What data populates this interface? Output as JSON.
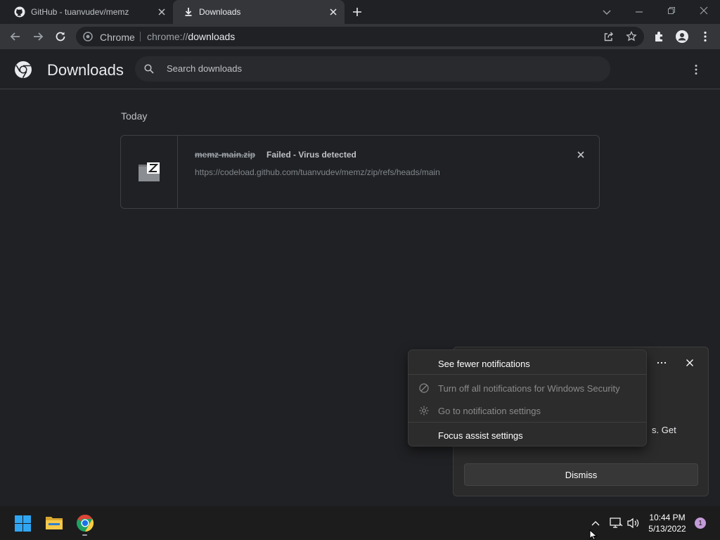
{
  "browser": {
    "tabs": [
      {
        "label": "GitHub - tuanvudev/memz",
        "icon": "github-icon",
        "active": false
      },
      {
        "label": "Downloads",
        "icon": "download-icon",
        "active": true
      }
    ],
    "omnibox": {
      "chip": "Chrome",
      "url_prefix": "chrome://",
      "url_path": "downloads"
    }
  },
  "downloads_page": {
    "title": "Downloads",
    "search_placeholder": "Search downloads",
    "sections": [
      {
        "heading": "Today",
        "items": [
          {
            "filename": "memz-main.zip",
            "status": "Failed - Virus detected",
            "url": "https://codeload.github.com/tuanvudev/memz/zip/refs/heads/main"
          }
        ]
      }
    ]
  },
  "notification": {
    "text_fragment": "s. Get",
    "dismiss_label": "Dismiss",
    "menu": [
      {
        "label": "See fewer notifications",
        "enabled": true,
        "icon": null
      },
      {
        "label": "Turn off all notifications for Windows Security",
        "enabled": false,
        "icon": "block-icon"
      },
      {
        "label": "Go to notification settings",
        "enabled": false,
        "icon": "gear-icon"
      },
      {
        "label": "Focus assist settings",
        "enabled": true,
        "icon": null
      }
    ]
  },
  "taskbar": {
    "time": "10:44 PM",
    "date": "5/13/2022",
    "notification_count": "1"
  },
  "colors": {
    "accent_badge": "#c49bd8",
    "windows_blue": "#2fa6f4",
    "folder_yellow": "#f7c948"
  }
}
